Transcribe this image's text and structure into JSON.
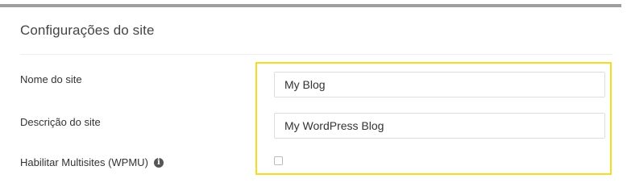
{
  "panel": {
    "title": "Configurações do site"
  },
  "fields": {
    "site_name": {
      "label": "Nome do site",
      "value": "My Blog"
    },
    "site_description": {
      "label": "Descrição do site",
      "value": "My WordPress Blog"
    },
    "multisite": {
      "label": "Habilitar Multisites (WPMU)",
      "checked": false,
      "info_icon": "info-circle-icon"
    }
  },
  "colors": {
    "highlight": "#f4dc1e",
    "top_bar": "#9e9e9e"
  }
}
